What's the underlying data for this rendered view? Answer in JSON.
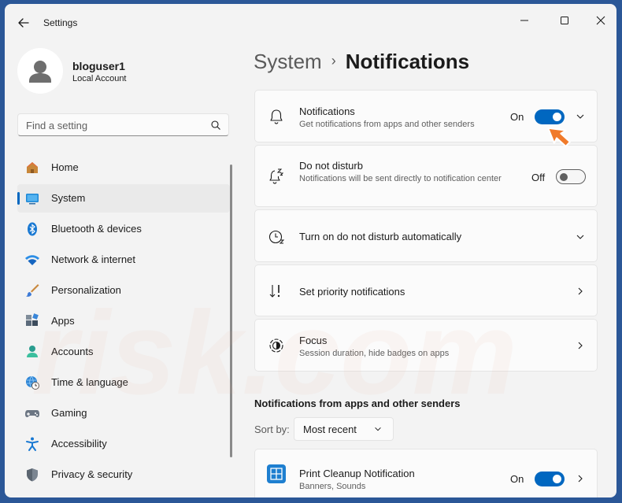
{
  "window": {
    "title": "Settings",
    "accent": "#0067c0"
  },
  "profile": {
    "name": "bloguser1",
    "account_type": "Local Account"
  },
  "search": {
    "placeholder": "Find a setting"
  },
  "nav": {
    "items": [
      {
        "label": "Home",
        "icon": "home-icon",
        "active": false
      },
      {
        "label": "System",
        "icon": "system-icon",
        "active": true
      },
      {
        "label": "Bluetooth & devices",
        "icon": "bluetooth-icon",
        "active": false
      },
      {
        "label": "Network & internet",
        "icon": "wifi-icon",
        "active": false
      },
      {
        "label": "Personalization",
        "icon": "brush-icon",
        "active": false
      },
      {
        "label": "Apps",
        "icon": "apps-icon",
        "active": false
      },
      {
        "label": "Accounts",
        "icon": "person-icon",
        "active": false
      },
      {
        "label": "Time & language",
        "icon": "globe-clock-icon",
        "active": false
      },
      {
        "label": "Gaming",
        "icon": "gamepad-icon",
        "active": false
      },
      {
        "label": "Accessibility",
        "icon": "accessibility-icon",
        "active": false
      },
      {
        "label": "Privacy & security",
        "icon": "shield-icon",
        "active": false
      }
    ]
  },
  "breadcrumb": {
    "parent": "System",
    "separator": "›",
    "current": "Notifications"
  },
  "cards": {
    "notifications": {
      "title": "Notifications",
      "description": "Get notifications from apps and other senders",
      "state_label": "On",
      "on": true
    },
    "do_not_disturb": {
      "title": "Do not disturb",
      "description": "Notifications will be sent directly to notification center",
      "state_label": "Off",
      "on": false
    },
    "auto_dnd": {
      "title": "Turn on do not disturb automatically"
    },
    "priority": {
      "title": "Set priority notifications"
    },
    "focus": {
      "title": "Focus",
      "description": "Session duration, hide badges on apps"
    }
  },
  "senders": {
    "section_title": "Notifications from apps and other senders",
    "sort_label": "Sort by:",
    "sort_value": "Most recent",
    "apps": [
      {
        "name": "Print Cleanup Notification",
        "detail": "Banners, Sounds",
        "state_label": "On",
        "on": true
      }
    ]
  },
  "watermark": "risk.com"
}
